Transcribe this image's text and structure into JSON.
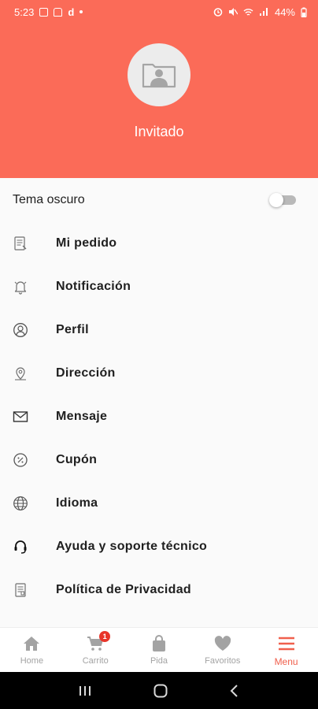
{
  "status_bar": {
    "time": "5:23",
    "carrier_letter": "d",
    "battery": "44%"
  },
  "header": {
    "username": "Invitado",
    "background_color": "#fb6b58",
    "avatar_icon": "user-photo-icon"
  },
  "dark_mode": {
    "label": "Tema oscuro",
    "enabled": false
  },
  "menu": {
    "items": [
      {
        "label": "Mi pedido",
        "icon": "order-list-icon"
      },
      {
        "label": "Notificación",
        "icon": "bell-icon"
      },
      {
        "label": "Perfil",
        "icon": "profile-icon"
      },
      {
        "label": "Dirección",
        "icon": "location-pin-icon"
      },
      {
        "label": "Mensaje",
        "icon": "envelope-icon"
      },
      {
        "label": "Cupón",
        "icon": "coupon-icon"
      },
      {
        "label": "Idioma",
        "icon": "globe-icon"
      },
      {
        "label": "Ayuda y soporte técnico",
        "icon": "headset-icon"
      },
      {
        "label": "Política de Privacidad",
        "icon": "document-icon"
      }
    ]
  },
  "bottom_nav": {
    "items": [
      {
        "label": "Home",
        "icon": "home-icon"
      },
      {
        "label": "Carrito",
        "icon": "cart-icon",
        "badge": "1"
      },
      {
        "label": "Pida",
        "icon": "bag-icon"
      },
      {
        "label": "Favoritos",
        "icon": "heart-icon"
      },
      {
        "label": "Menu",
        "icon": "menu-icon",
        "active": true
      }
    ],
    "accent_color": "#f0604d",
    "inactive_color": "#a3a3a3"
  }
}
